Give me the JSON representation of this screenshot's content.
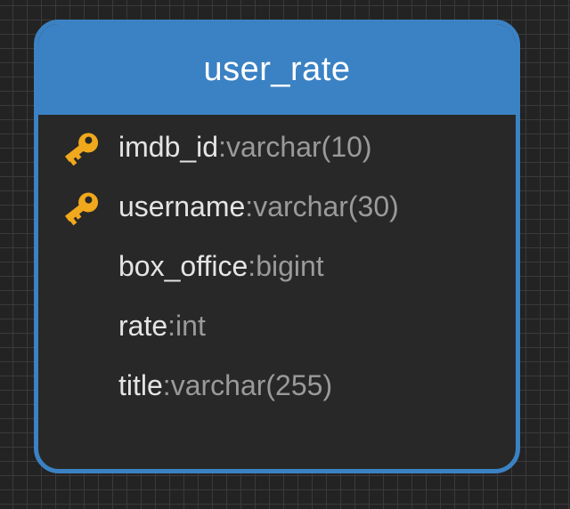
{
  "table": {
    "title": "user_rate",
    "header_color": "#3b82c4",
    "columns": [
      {
        "name": "imdb_id",
        "sep": ":",
        "type": " varchar(10)",
        "primary_key": true,
        "icon": "key-icon"
      },
      {
        "name": "username",
        "sep": ":",
        "type": " varchar(30)",
        "primary_key": true,
        "icon": "key-icon"
      },
      {
        "name": "box_office",
        "sep": ":",
        "type": " bigint",
        "primary_key": false
      },
      {
        "name": "rate",
        "sep": ":",
        "type": " int",
        "primary_key": false
      },
      {
        "name": "title",
        "sep": ":",
        "type": " varchar(255)",
        "primary_key": false
      }
    ]
  },
  "colors": {
    "key": "#f0a81c",
    "canvas": "#232323",
    "card": "#282828"
  }
}
